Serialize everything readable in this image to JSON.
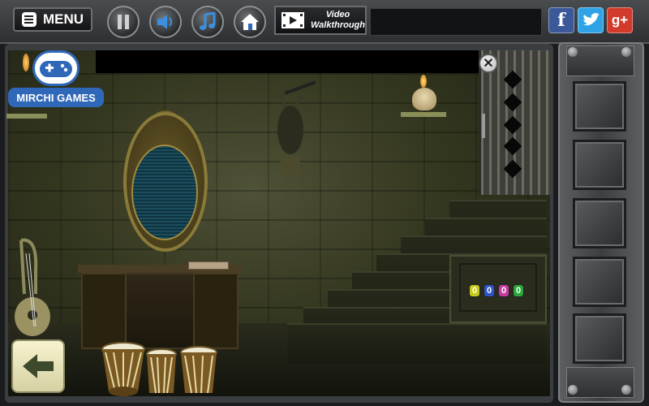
{
  "topbar": {
    "menu_label": "MENU",
    "buttons": [
      {
        "name": "pause-button",
        "icon": "pause-icon"
      },
      {
        "name": "sound-button",
        "icon": "speaker-icon"
      },
      {
        "name": "music-button",
        "icon": "music-note-icon"
      },
      {
        "name": "home-button",
        "icon": "home-icon"
      }
    ],
    "video": {
      "line1": "Video",
      "line2": "Walkthrough",
      "icon": "film-strip-icon"
    },
    "social": [
      {
        "name": "facebook",
        "label": "f",
        "color": "#3b5998"
      },
      {
        "name": "twitter",
        "label": "t",
        "color": "#2fa3e6"
      },
      {
        "name": "google-plus",
        "label": "g+",
        "color": "#d23b2b"
      }
    ]
  },
  "logo": {
    "text": "MIRCHI GAMES",
    "icon": "gamepad-icon"
  },
  "scene": {
    "code_digits": [
      {
        "value": "0",
        "color": "#c9c91a"
      },
      {
        "value": "0",
        "color": "#2e56c9"
      },
      {
        "value": "0",
        "color": "#c93aa0"
      },
      {
        "value": "0",
        "color": "#2aa63a"
      }
    ],
    "objects": [
      "mirror",
      "deer-head",
      "skull-candle",
      "desk",
      "book",
      "stairs",
      "door",
      "harp-guitar",
      "tabla-drums"
    ]
  },
  "controls": {
    "back_icon": "left-arrow-icon",
    "close_icon": "close-icon",
    "close_label": "✕"
  },
  "inventory": {
    "slots": 5
  }
}
